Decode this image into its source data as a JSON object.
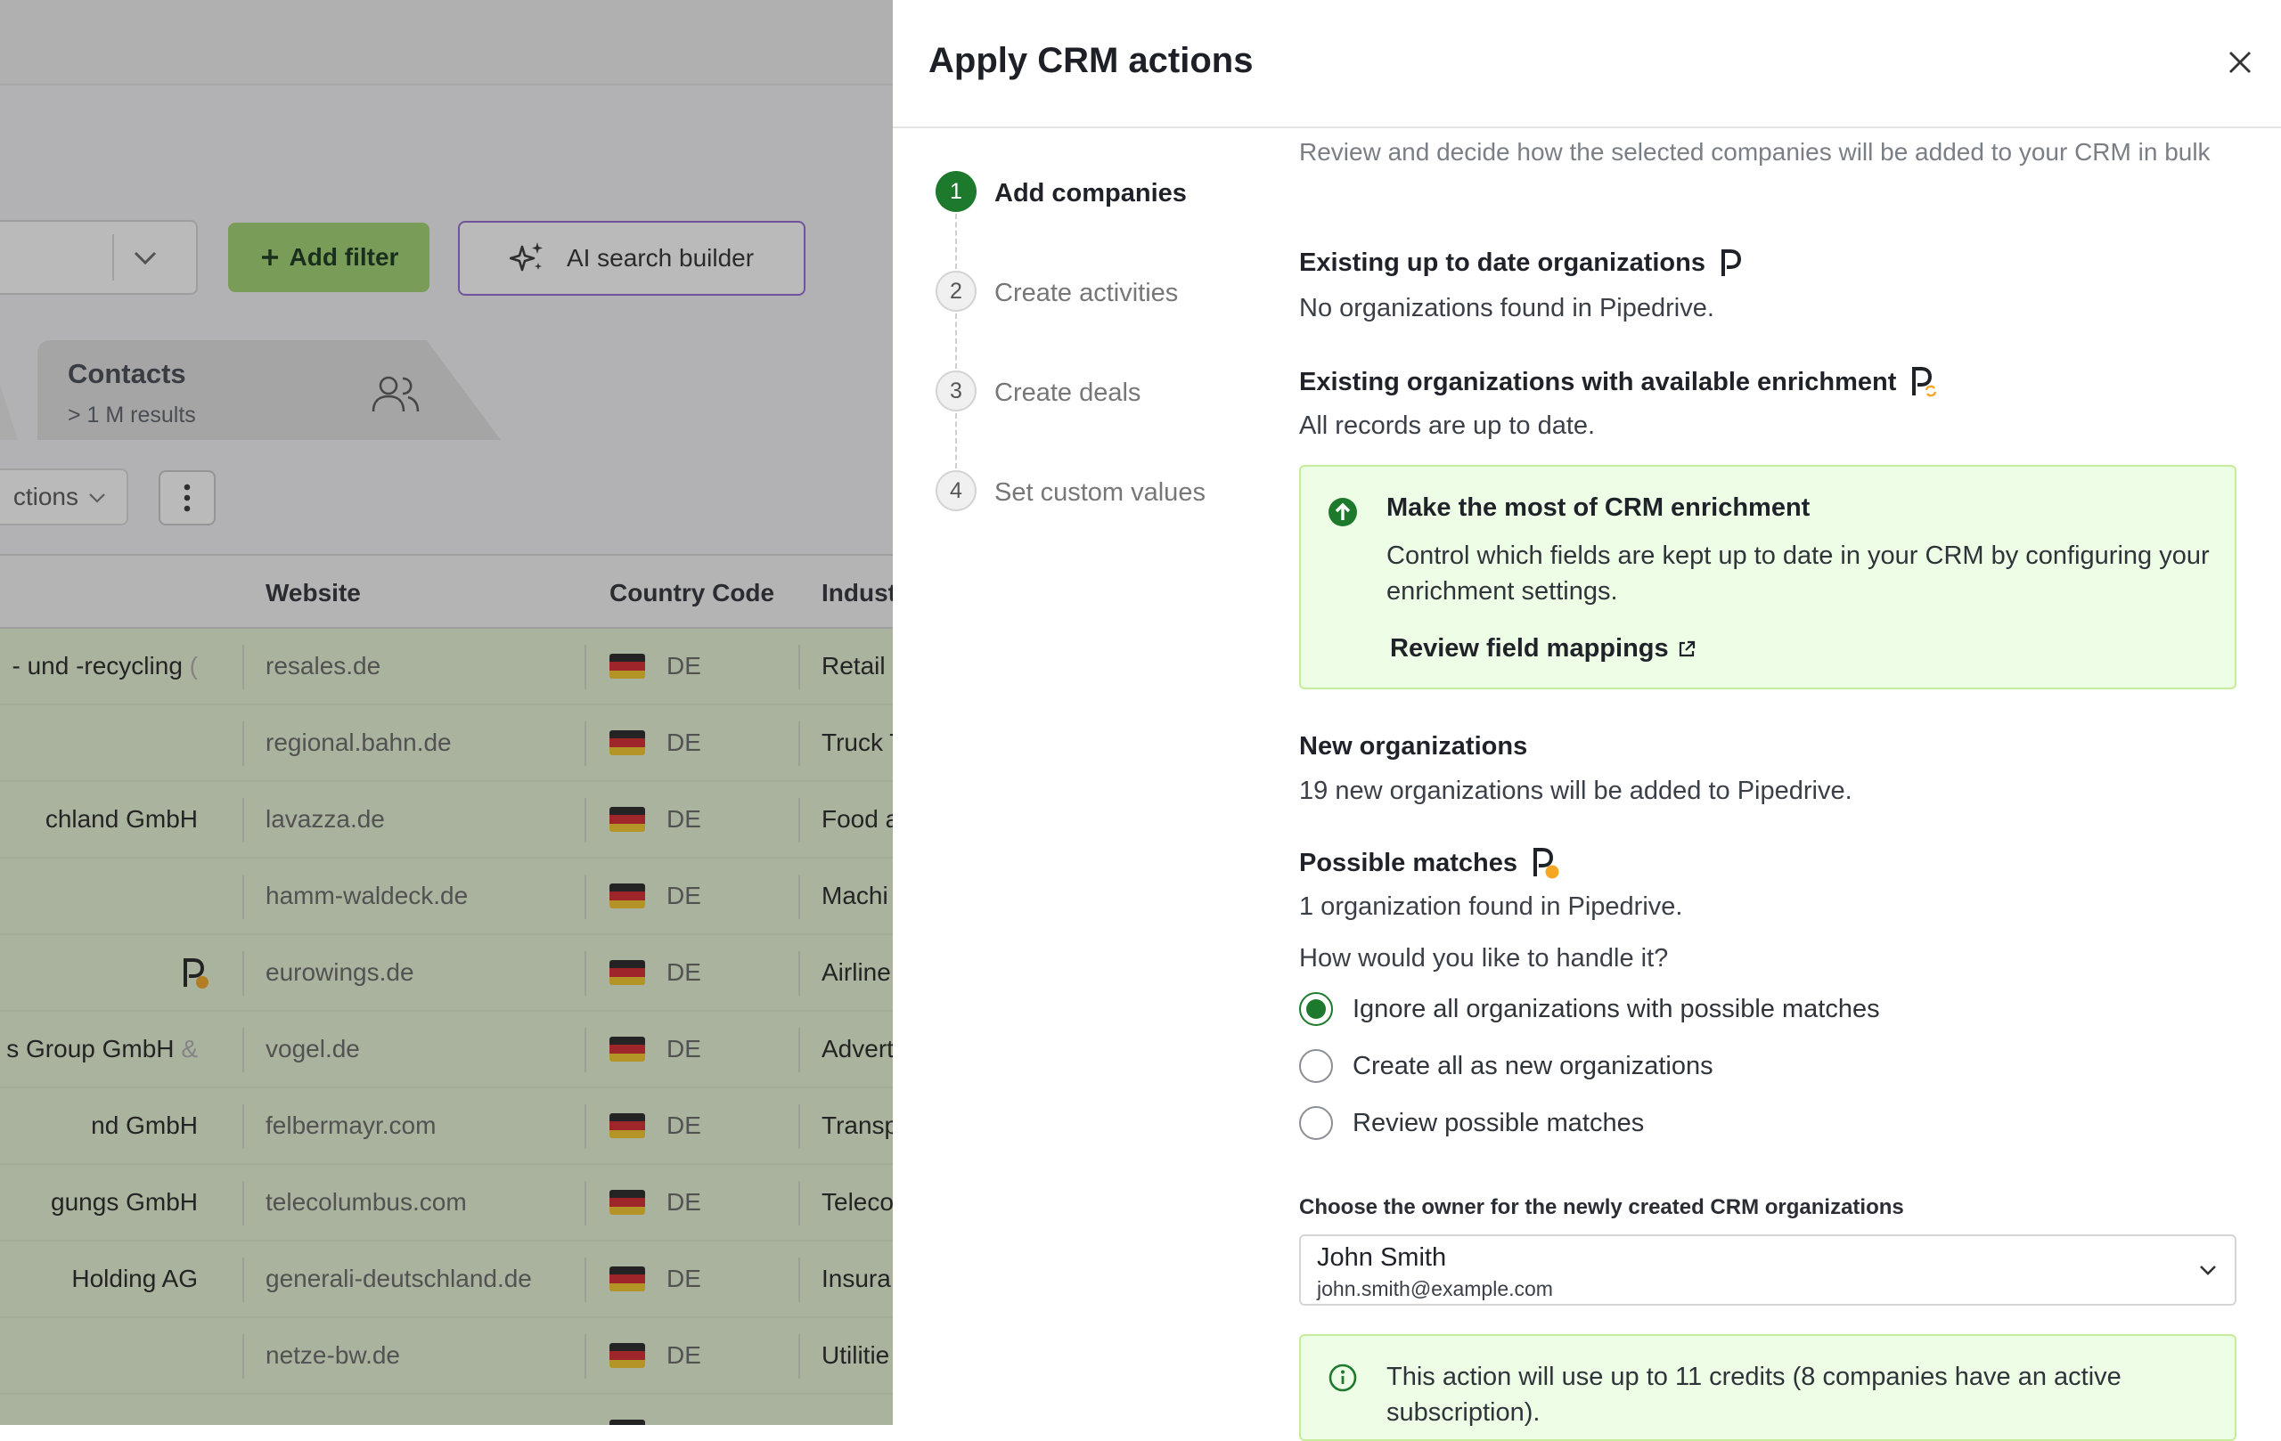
{
  "background": {
    "add_filter_label": "Add filter",
    "ai_search_label": "AI search builder",
    "contacts_tab": {
      "title": "Contacts",
      "subtitle": "> 1 M results"
    },
    "actions_label": "ctions",
    "columns": {
      "website": "Website",
      "country_code": "Country Code",
      "industry": "Indust"
    },
    "rows": [
      {
        "name": "- und -recycling",
        "name_suffix": "(",
        "website": "resales.de",
        "country": "DE",
        "industry": "Retail"
      },
      {
        "name": "",
        "name_suffix": "",
        "website": "regional.bahn.de",
        "country": "DE",
        "industry": "Truck T"
      },
      {
        "name": "chland GmbH",
        "name_suffix": "",
        "website": "lavazza.de",
        "country": "DE",
        "industry": "Food a"
      },
      {
        "name": "",
        "name_suffix": "",
        "website": "hamm-waldeck.de",
        "country": "DE",
        "industry": "Machi"
      },
      {
        "name": "",
        "name_suffix": "",
        "website": "eurowings.de",
        "country": "DE",
        "industry": "Airline"
      },
      {
        "name": "s Group GmbH",
        "name_suffix": "&",
        "website": "vogel.de",
        "country": "DE",
        "industry": "Advert"
      },
      {
        "name": "nd GmbH",
        "name_suffix": "",
        "website": "felbermayr.com",
        "country": "DE",
        "industry": "Transp"
      },
      {
        "name": "gungs GmbH",
        "name_suffix": "",
        "website": "telecolumbus.com",
        "country": "DE",
        "industry": "Teleco"
      },
      {
        "name": "Holding AG",
        "name_suffix": "",
        "website": "generali-deutschland.de",
        "country": "DE",
        "industry": "Insura"
      },
      {
        "name": "",
        "name_suffix": "",
        "website": "netze-bw.de",
        "country": "DE",
        "industry": "Utilitie"
      }
    ]
  },
  "drawer": {
    "title": "Apply CRM actions",
    "steps": [
      {
        "number": "1",
        "label": "Add companies"
      },
      {
        "number": "2",
        "label": "Create activities"
      },
      {
        "number": "3",
        "label": "Create deals"
      },
      {
        "number": "4",
        "label": "Set custom values"
      }
    ],
    "intro_text": "Review and decide how the selected companies will be added to your CRM in bulk",
    "existing_up_to_date": {
      "title": "Existing up to date organizations",
      "text": "No organizations found in Pipedrive."
    },
    "existing_enrichment": {
      "title": "Existing organizations with available enrichment",
      "text": "All records are up to date."
    },
    "promo": {
      "title": "Make the most of CRM enrichment",
      "text": "Control which fields are kept up to date in your CRM by configuring your enrichment settings.",
      "link": "Review field mappings"
    },
    "new_orgs": {
      "title": "New organizations",
      "text": "19 new organizations will be added to Pipedrive."
    },
    "possible_matches": {
      "title": "Possible matches",
      "text": "1 organization found in Pipedrive.",
      "question": "How would you like to handle it?",
      "options": [
        {
          "label": "Ignore all organizations with possible matches",
          "selected": true
        },
        {
          "label": "Create all as new organizations",
          "selected": false
        },
        {
          "label": "Review possible matches",
          "selected": false
        }
      ]
    },
    "owner": {
      "label": "Choose the owner for the newly created CRM organizations",
      "name": "John Smith",
      "email": "john.smith@example.com"
    },
    "credits_info": "This action will use up to 11 credits (8 companies have an active subscription)."
  },
  "colors": {
    "primary_green": "#1d7a2d",
    "add_filter_green": "#9fd46f",
    "ai_purple": "#9466d4",
    "promo_bg": "#eefde5",
    "row_bg": "#e7f5d6",
    "pipedrive_badge": "#f5a623"
  },
  "icons": [
    "chevron-down-icon",
    "plus-icon",
    "sparkle-icon",
    "people-icon",
    "more-vertical-icon",
    "close-icon",
    "pipedrive-icon",
    "arrow-up-circle-icon",
    "external-link-icon",
    "info-icon",
    "de-flag-icon"
  ]
}
